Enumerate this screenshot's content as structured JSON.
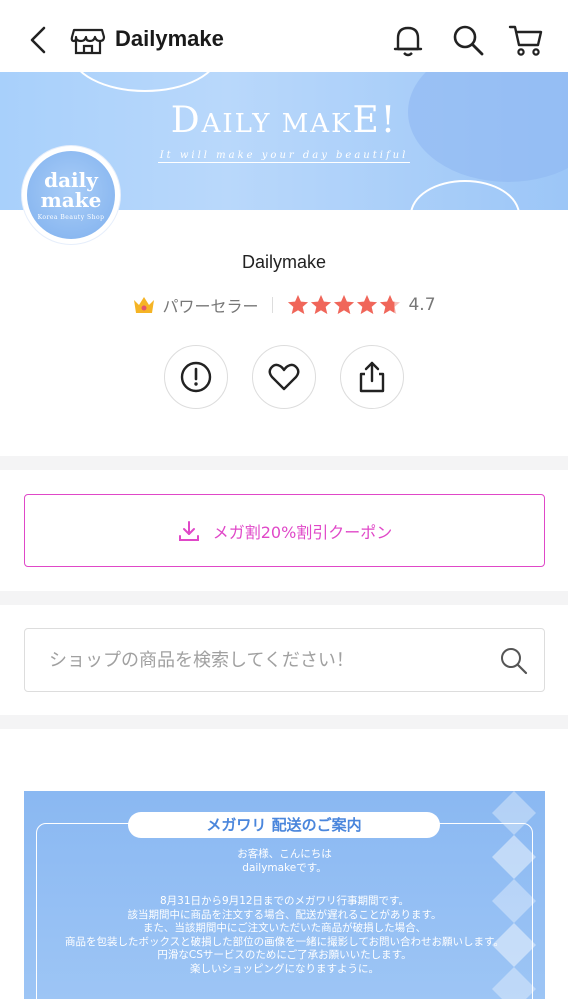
{
  "header": {
    "shop_name": "Dailymake"
  },
  "banner": {
    "title_big_d": "D",
    "title_rest": "AILY MAK",
    "title_e": "E",
    "title_excl": "!",
    "tagline": "It will make your day beautiful"
  },
  "logo": {
    "line1": "daily",
    "line2": "make",
    "line3": "Korea Beauty Shop"
  },
  "shop": {
    "title": "Dailymake",
    "seller_label": "パワーセラー",
    "rating": "4.7",
    "stars": 4.7
  },
  "coupon": {
    "label": "メガ割20%割引クーポン"
  },
  "search": {
    "placeholder": "ショップの商品を検索してください！"
  },
  "notice": {
    "pill": "メガワリ 配送のご案内",
    "greet1": "お客様、こんにちは",
    "greet2": "dailymakeです。",
    "lines": [
      "8月31日から9月12日までのメガワリ行事期間です。",
      "該当期間中に商品を注文する場合、配送が遅れることがあります。",
      "また、当該期間中にご注文いただいた商品が破損した場合、",
      "商品を包装したボックスと破損した部位の画像を一緒に撮影してお問い合わせお願いします。",
      "円滑なCSサービスのためにご了承お願いいたします。",
      "楽しいショッピングになりますように。"
    ]
  },
  "colors": {
    "accent_pink": "#e048c8",
    "star": "#f0665a",
    "banner_blue": "#a8d0fb"
  }
}
